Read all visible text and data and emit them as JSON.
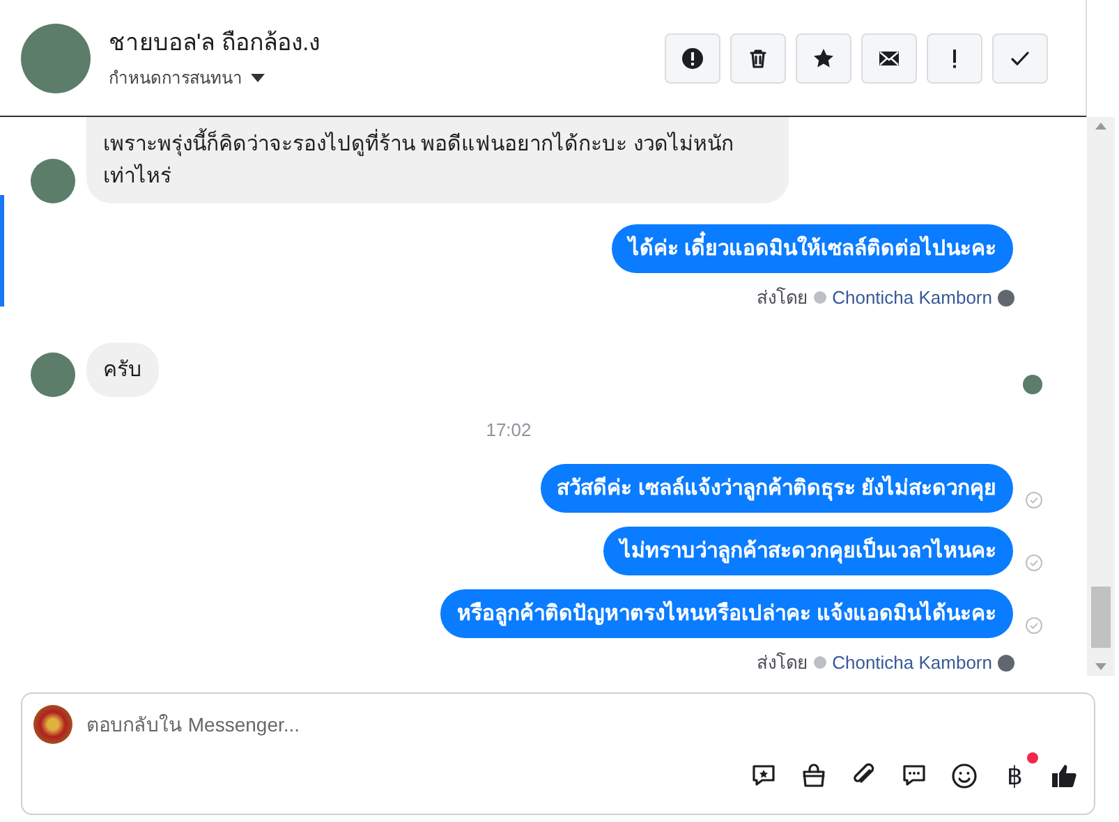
{
  "header": {
    "name": "ชายบอล'ล ถือกล้อง.ง",
    "subtitle": "กำหนดการสนทนา",
    "actions": [
      {
        "kind": "alert"
      },
      {
        "kind": "trash"
      },
      {
        "kind": "star"
      },
      {
        "kind": "mail"
      },
      {
        "kind": "exclaim"
      },
      {
        "kind": "check"
      }
    ]
  },
  "messages": [
    {
      "kind": "incoming",
      "text": "เพราะพรุ่งนี้ก็คิดว่าจะรองไปดูที่ร้าน พอดีแฟนอยากได้กะบะ งวดไม่หนัก\nเท่าไหร่",
      "seen_marker": false
    },
    {
      "kind": "outgoing",
      "text": "ได้ค่ะ เดี๋ยวแอดมินให้เซลล์ติดต่อไปนะคะ",
      "delivered": false
    },
    {
      "kind": "sender",
      "prefix": "ส่งโดย",
      "name": "Chonticha Kamborn"
    },
    {
      "kind": "incoming",
      "text": "ครับ",
      "seen_marker": true
    },
    {
      "kind": "time",
      "text": "17:02"
    },
    {
      "kind": "outgoing",
      "text": "สวัสดีค่ะ เซลล์แจ้งว่าลูกค้าติดธุระ ยังไม่สะดวกคุย",
      "delivered": true
    },
    {
      "kind": "outgoing",
      "text": "ไม่ทราบว่าลูกค้าสะดวกคุยเป็นเวลาไหนคะ",
      "delivered": true
    },
    {
      "kind": "outgoing",
      "text": "หรือลูกค้าติดปัญหาตรงไหนหรือเปล่าคะ แจ้งแอดมินได้นะคะ",
      "delivered": true
    },
    {
      "kind": "sender",
      "prefix": "ส่งโดย",
      "name": "Chonticha Kamborn"
    }
  ],
  "composer": {
    "placeholder": "ตอบกลับใน Messenger...",
    "tools": [
      {
        "kind": "sticker"
      },
      {
        "kind": "bag"
      },
      {
        "kind": "clip"
      },
      {
        "kind": "chat"
      },
      {
        "kind": "smile"
      },
      {
        "kind": "baht",
        "text": "฿",
        "badge": true
      },
      {
        "kind": "like"
      }
    ]
  }
}
